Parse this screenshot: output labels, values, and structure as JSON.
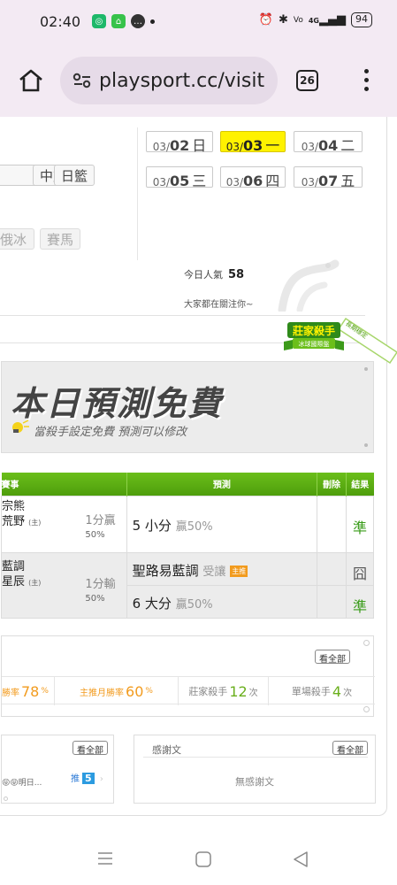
{
  "status_bar": {
    "time": "02:40",
    "battery": "94",
    "network": "4G"
  },
  "browser": {
    "url": "playsport.cc/visit",
    "tab_count": "26"
  },
  "sports": {
    "row1": [
      "中籃",
      "日籃"
    ],
    "row2": [
      "俄冰",
      "賽馬"
    ]
  },
  "dates": [
    {
      "md": "03/",
      "d": "02",
      "w": "日",
      "active": false
    },
    {
      "md": "03/",
      "d": "03",
      "w": "一",
      "active": true
    },
    {
      "md": "03/",
      "d": "04",
      "w": "二",
      "active": false
    },
    {
      "md": "03/",
      "d": "05",
      "w": "三",
      "active": false
    },
    {
      "md": "03/",
      "d": "06",
      "w": "四",
      "active": false
    },
    {
      "md": "03/",
      "d": "07",
      "w": "五",
      "active": false
    }
  ],
  "popularity": {
    "label": "今日人氣",
    "value": "58",
    "watching": "大家都在關注你~"
  },
  "badge": {
    "title": "莊家殺手",
    "subtitle": "冰球國際盤",
    "ribbon": "長期穩定"
  },
  "banner": {
    "title": "本日預測免費",
    "subtitle": "當殺手設定免費  預測可以修改"
  },
  "table": {
    "headers": [
      "賽事",
      "預測",
      "刪除",
      "結果"
    ],
    "rows": [
      {
        "team1": "宗熊",
        "team2": "荒野",
        "home_mark": "(主)",
        "handicap": "1分贏",
        "handicap_pct": "50%",
        "predictions": [
          {
            "pick": "5 小分",
            "note": "贏50%",
            "result": "準"
          }
        ]
      },
      {
        "team1": "藍調",
        "team2": "星辰",
        "home_mark": "(主)",
        "handicap": "1分輸",
        "handicap_pct": "50%",
        "predictions": [
          {
            "pick": "聖路易藍調",
            "note": "受讓",
            "tag": "主推",
            "result": "囧"
          },
          {
            "pick": "6 大分",
            "note": "贏50%",
            "result": "準"
          }
        ]
      }
    ]
  },
  "stats": {
    "see_all": "看全部",
    "items": [
      {
        "label": "勝率",
        "value": "78",
        "unit": "%"
      },
      {
        "label": "主推月勝率",
        "value": "60",
        "unit": "%"
      },
      {
        "label": "莊家殺手",
        "value": "12",
        "unit": "次"
      },
      {
        "label": "單場殺手",
        "value": "4",
        "unit": "次"
      }
    ]
  },
  "left_panel": {
    "see_all": "看全部",
    "snippet": "😝😝明日...",
    "push_label": "推",
    "push_count": "5"
  },
  "thanks_panel": {
    "title": "感謝文",
    "see_all": "看全部",
    "empty": "無感謝文"
  },
  "colors": {
    "accent_green": "#5aab12",
    "accent_orange": "#f29b1e",
    "active_date": "#fff200",
    "chrome_bg": "#f3eaf3"
  }
}
